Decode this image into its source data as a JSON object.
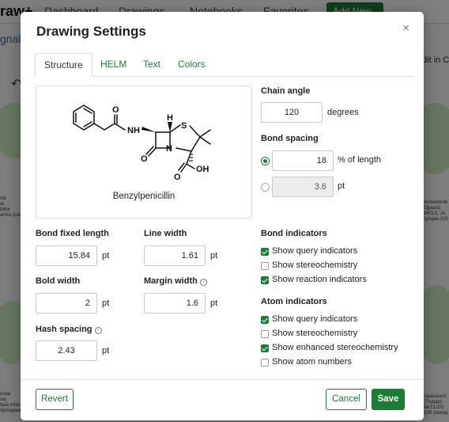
{
  "background": {
    "brand": "raw+",
    "nav": [
      "Dashboard",
      "Drawings",
      "Notebooks",
      "Favorites"
    ],
    "new_button": "Add New ▾",
    "signals": "gnals",
    "edit_in": ") Edit in C",
    "notes": [
      [
        "nib",
        "a)",
        "ibitor",
        "arma (Loxo"
      ],
      [
        "momelotinib",
        "(Ojjaara)",
        "JAK1/2, JA",
        "Cytopia (GS"
      ],
      [
        "ostat",
        "xa)",
        "tase inhibit",
        "Springwork"
      ],
      [
        "capivaserti",
        "(Truqap)",
        "AKT1/2/3",
        "ICR (Astraz"
      ]
    ]
  },
  "modal": {
    "title": "Drawing Settings",
    "close": "×",
    "tabs": [
      "Structure",
      "HELM",
      "Text",
      "Colors"
    ],
    "active_tab": "Structure",
    "preview": {
      "molecule_name": "Benzylpenicillin",
      "atoms": {
        "o_top": "O",
        "nh": "NH",
        "h": "H",
        "s": "S",
        "n": "N",
        "o_bottom": "O",
        "o_acid": "O",
        "oh": "OH"
      }
    },
    "chain_angle": {
      "label": "Chain angle",
      "value": "120",
      "unit": "degrees"
    },
    "bond_spacing": {
      "label": "Bond spacing",
      "percent_value": "18",
      "percent_unit": "% of length",
      "pt_value": "3.6",
      "pt_unit": "pt",
      "selected": "percent"
    },
    "bond_fixed_length": {
      "label": "Bond fixed length",
      "value": "15.84",
      "unit": "pt"
    },
    "line_width": {
      "label": "Line width",
      "value": "1.61",
      "unit": "pt"
    },
    "bold_width": {
      "label": "Bold width",
      "value": "2",
      "unit": "pt"
    },
    "margin_width": {
      "label": "Margin width",
      "value": "1.6",
      "unit": "pt"
    },
    "hash_spacing": {
      "label": "Hash spacing",
      "value": "2.43",
      "unit": "pt"
    },
    "info_icon": "i",
    "bond_indicators": {
      "label": "Bond indicators",
      "items": [
        {
          "label": "Show query indicators",
          "checked": true
        },
        {
          "label": "Show stereochemistry",
          "checked": false
        },
        {
          "label": "Show reaction indicators",
          "checked": true
        }
      ]
    },
    "atom_indicators": {
      "label": "Atom indicators",
      "items": [
        {
          "label": "Show query indicators",
          "checked": true
        },
        {
          "label": "Show stereochemistry",
          "checked": false
        },
        {
          "label": "Show enhanced stereochemistry",
          "checked": true
        },
        {
          "label": "Show atom numbers",
          "checked": false
        }
      ]
    },
    "buttons": {
      "revert": "Revert",
      "cancel": "Cancel",
      "save": "Save"
    }
  },
  "colors": {
    "accent": "#1b7c34",
    "overlay": "rgba(0,0,0,0.50)"
  }
}
